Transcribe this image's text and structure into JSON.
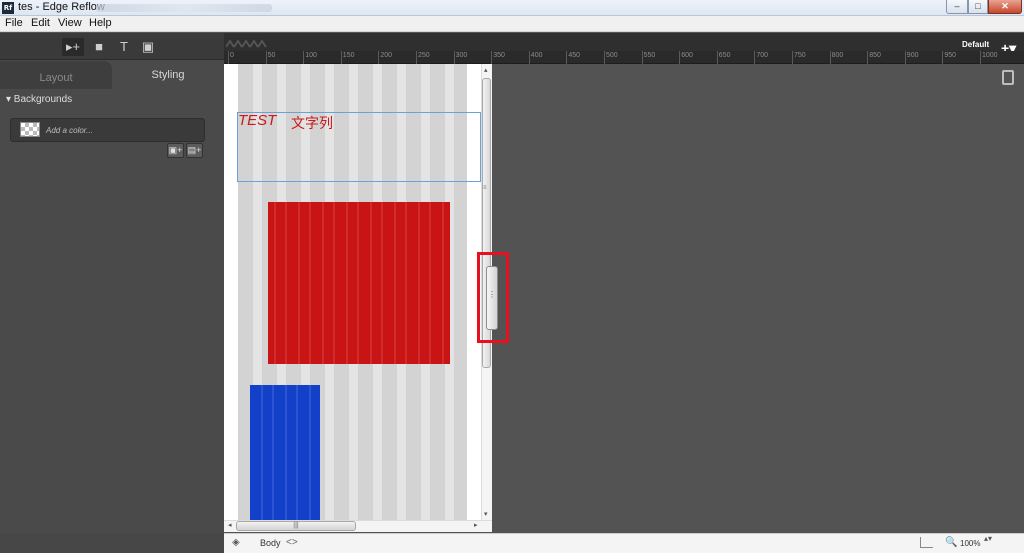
{
  "window": {
    "app_icon": "Rf",
    "title": "tes - Edge Reflow",
    "min": "–",
    "max": "□",
    "close": "✕"
  },
  "menu": [
    "File",
    "Edit",
    "View",
    "Help"
  ],
  "toolbar": {
    "select_icon": "▸+",
    "box_icon": "■",
    "text_icon": "T",
    "image_icon": "▣"
  },
  "tabs": {
    "layout": "Layout",
    "styling": "Styling"
  },
  "panel": {
    "backgrounds_label": "▾ Backgrounds",
    "add_color": "Add a color...",
    "add_image": "▣+",
    "add_gradient": "▤+"
  },
  "ruler": {
    "ticks": [
      "0",
      "50",
      "100",
      "150",
      "200",
      "250",
      "300",
      "350",
      "400",
      "450",
      "500",
      "550",
      "600",
      "650",
      "700",
      "750",
      "800",
      "850",
      "900",
      "950",
      "1000"
    ],
    "breakpoint": "Default",
    "add_breakpoint": "+▾"
  },
  "canvas": {
    "text_test": "TEST",
    "text_jp": "文字列",
    "handle_grip": "⋮"
  },
  "scroll": {
    "up": "▴",
    "down": "▾",
    "left": "◂",
    "right": "▸",
    "h_grip": "|||",
    "v_grip": "≡"
  },
  "status": {
    "layers_icon": "◈",
    "breadcrumb": "Body",
    "breadcrumb_nav": "<>",
    "zoom_icon": "🔍",
    "zoom": "100%",
    "zoom_stepper": "▴▾"
  },
  "colors": {
    "accent_red": "#c81414",
    "accent_blue": "#1240c8",
    "highlight": "#e8101e"
  }
}
